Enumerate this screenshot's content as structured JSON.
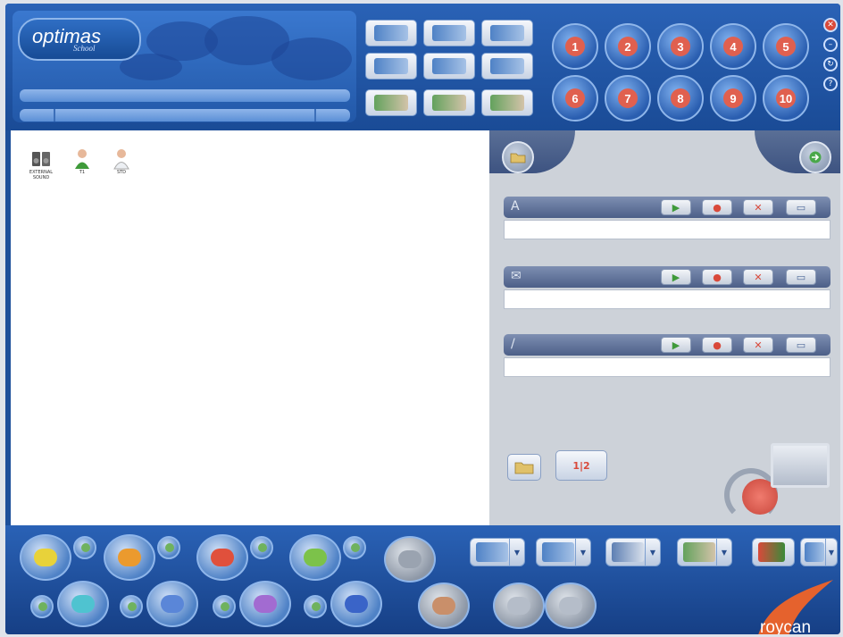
{
  "logo": {
    "name": "optimas",
    "registered": "®",
    "subtitle": "School"
  },
  "toolbar": {
    "buttons": [
      {
        "name": "video-send"
      },
      {
        "name": "video-receive"
      },
      {
        "name": "video-control"
      },
      {
        "name": "audio-send"
      },
      {
        "name": "audio-receive"
      },
      {
        "name": "audio-control"
      },
      {
        "name": "student-view"
      },
      {
        "name": "teacher-view"
      },
      {
        "name": "class-view"
      }
    ]
  },
  "numbered_buttons": [
    "1",
    "2",
    "3",
    "4",
    "5",
    "6",
    "7",
    "8",
    "9",
    "10"
  ],
  "window_controls": {
    "close": "✕",
    "minimize": "–",
    "refresh": "↻",
    "help": "?"
  },
  "desktop": {
    "items": [
      {
        "label": "EXTERNAL SOUND",
        "icon": "speaker-icon"
      },
      {
        "label": "T1",
        "icon": "student-green-icon"
      },
      {
        "label": "STD",
        "icon": "student-white-icon"
      }
    ]
  },
  "right_panel": {
    "strips": [
      {
        "icon": "A",
        "play": "▶",
        "record": "●",
        "delete": "✕",
        "extra": "▭"
      },
      {
        "icon": "✉",
        "play": "▶",
        "record": "●",
        "delete": "✕",
        "extra": "▭"
      },
      {
        "icon": "/",
        "play": "▶",
        "record": "●",
        "delete": "✕",
        "extra": "▭"
      }
    ],
    "lower_button_label": "1|2"
  },
  "footer": {
    "brand": "roycan",
    "groups": [
      "yellow",
      "orange",
      "red",
      "green",
      "cyan",
      "blue",
      "purple",
      "blue2"
    ]
  },
  "colors": {
    "primary": "#1d4f9a",
    "accent": "#2a62b6",
    "panel": "#cdd2d9"
  }
}
